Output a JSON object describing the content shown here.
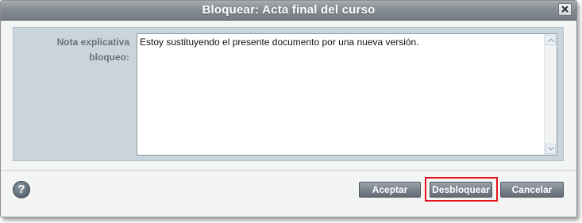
{
  "dialog": {
    "title": "Bloquear: Acta final del curso",
    "close_icon": "close-icon"
  },
  "form": {
    "label": "Nota explicativa\nbloqueo:",
    "textarea_value": "Estoy sustituyendo el presente documento por una nueva versión."
  },
  "footer": {
    "help_label": "?",
    "buttons": {
      "accept": "Aceptar",
      "unlock": "Desbloquear",
      "cancel": "Cancelar"
    },
    "highlight_color": "#e3141c"
  },
  "colors": {
    "titlebar": "#868d93",
    "panel": "#c9d4dc",
    "button": "#7a838c"
  }
}
